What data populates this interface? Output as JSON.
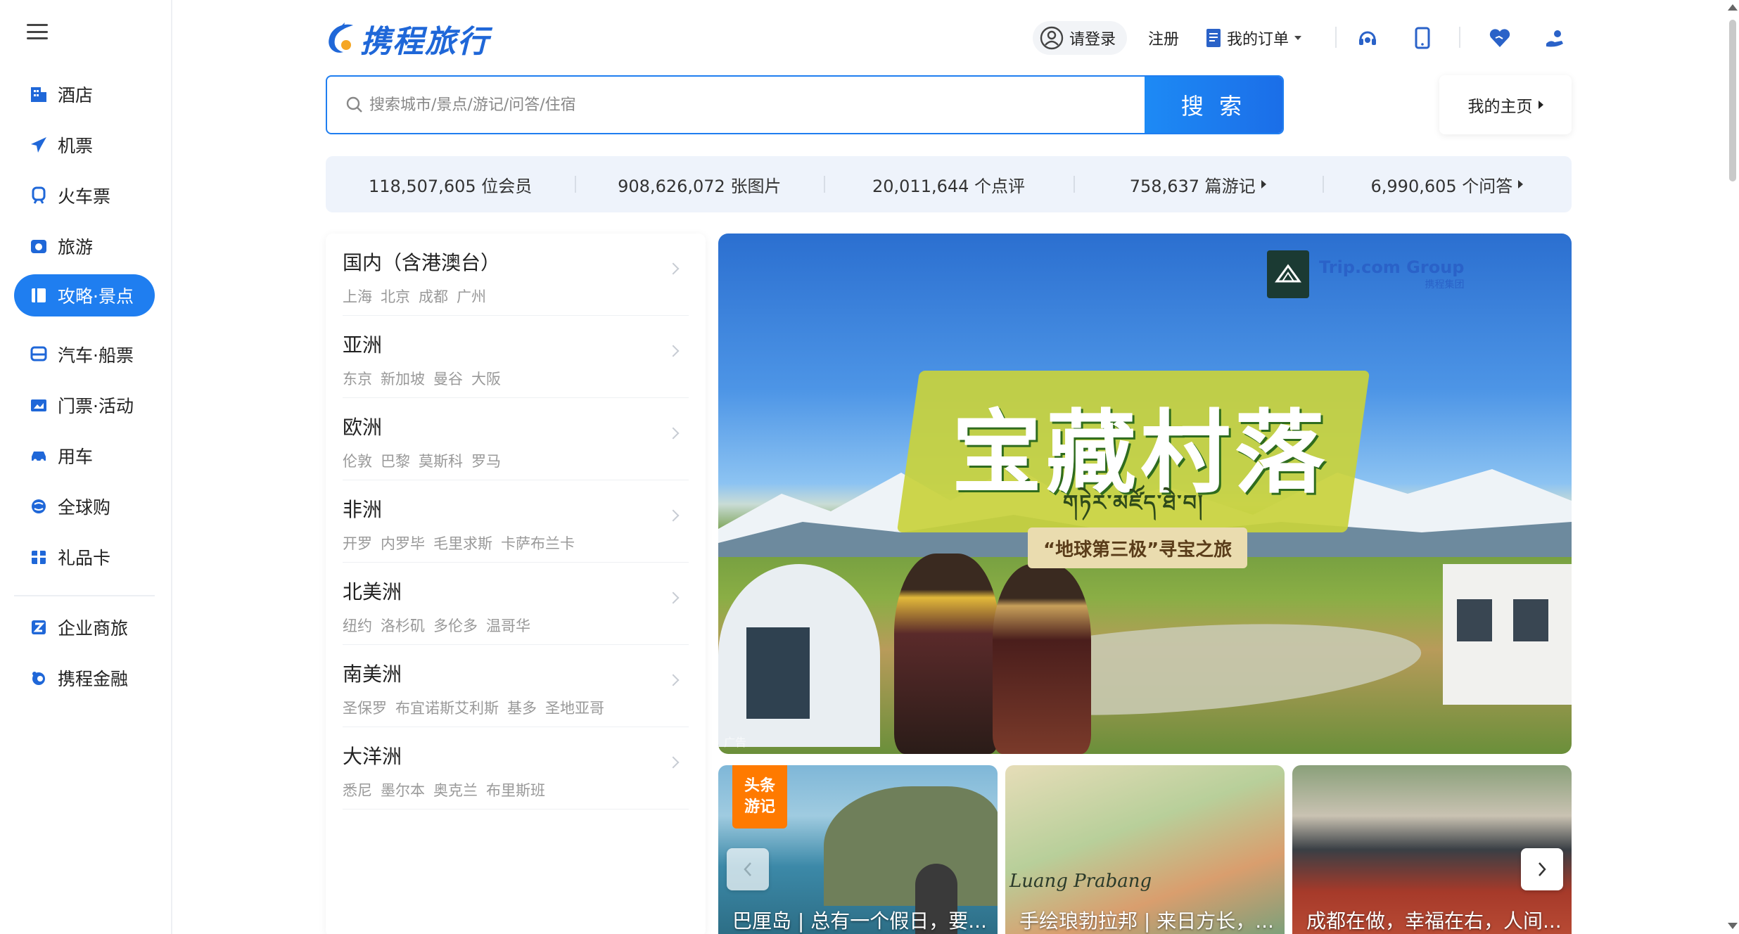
{
  "brand": {
    "name": "携程旅行",
    "logo_color": "#1f67d8"
  },
  "sidebar": {
    "items": [
      {
        "label": "酒店",
        "icon": "hotel-icon"
      },
      {
        "label": "机票",
        "icon": "plane-icon"
      },
      {
        "label": "火车票",
        "icon": "train-icon"
      },
      {
        "label": "旅游",
        "icon": "travel-icon"
      },
      {
        "label": "攻略·景点",
        "icon": "guide-icon",
        "active": true
      },
      {
        "label": "汽车·船票",
        "icon": "bus-icon"
      },
      {
        "label": "门票·活动",
        "icon": "ticket-icon"
      },
      {
        "label": "用车",
        "icon": "car-icon"
      },
      {
        "label": "全球购",
        "icon": "global-shop-icon"
      },
      {
        "label": "礼品卡",
        "icon": "gift-card-icon"
      },
      {
        "label": "企业商旅",
        "icon": "business-icon"
      },
      {
        "label": "携程金融",
        "icon": "finance-icon"
      }
    ],
    "accent": "#1f7ef0"
  },
  "header": {
    "login": "请登录",
    "register": "注册",
    "orders": "我的订单"
  },
  "search": {
    "placeholder": "搜索城市/景点/游记/问答/住宿",
    "button": "搜 索",
    "home": "我的主页"
  },
  "stats": [
    {
      "text": "118,507,605 位会员"
    },
    {
      "text": "908,626,072 张图片"
    },
    {
      "text": "20,011,644 个点评"
    },
    {
      "text": "758,637 篇游记",
      "link": true
    },
    {
      "text": "6,990,605 个问答",
      "link": true
    }
  ],
  "regions": [
    {
      "name": "国内（含港澳台）",
      "cities": [
        "上海",
        "北京",
        "成都",
        "广州"
      ]
    },
    {
      "name": "亚洲",
      "cities": [
        "东京",
        "新加坡",
        "曼谷",
        "大阪"
      ]
    },
    {
      "name": "欧洲",
      "cities": [
        "伦敦",
        "巴黎",
        "莫斯科",
        "罗马"
      ]
    },
    {
      "name": "非洲",
      "cities": [
        "开罗",
        "内罗毕",
        "毛里求斯",
        "卡萨布兰卡"
      ]
    },
    {
      "name": "北美洲",
      "cities": [
        "纽约",
        "洛杉矶",
        "多伦多",
        "温哥华"
      ]
    },
    {
      "name": "南美洲",
      "cities": [
        "圣保罗",
        "布宜诺斯艾利斯",
        "基多",
        "圣地亚哥"
      ]
    },
    {
      "name": "大洋洲",
      "cities": [
        "悉尼",
        "墨尔本",
        "奥克兰",
        "布里斯班"
      ]
    }
  ],
  "banner": {
    "title": "宝藏村落",
    "subtitle": "གཏེར་མཛོད་ཐེ་བ།",
    "tagline": "“地球第三极”寻宝之旅",
    "brand": "Trip.com Group",
    "brand_sub": "携程集团",
    "ad": "广告"
  },
  "cards": {
    "badge": "头条游记",
    "items": [
      {
        "caption": "巴厘岛 | 总有一个假日，要..."
      },
      {
        "caption": "手绘琅勃拉邦 | 来日方长，..."
      },
      {
        "caption": "成都在做，幸福在右，人间..."
      }
    ]
  }
}
